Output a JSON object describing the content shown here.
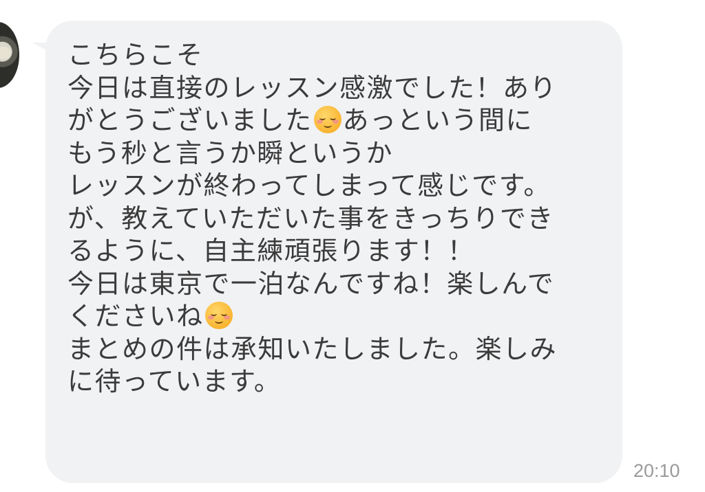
{
  "message": {
    "lines": [
      "こちらこそ",
      "今日は直接のレッスン感激でした！あり",
      "がとうございました",
      "あっという間に",
      "もう秒と言うか瞬というか",
      "レッスンが終わってしまって感じです。",
      "が、教えていただいた事をきっちりでき",
      "るように、自主練頑張ります！！",
      "今日は東京で一泊なんですね！楽しんで",
      "くださいね",
      "まとめの件は承知いたしました。楽しみ",
      "に待っています。"
    ],
    "emoji_name": "smiling-face-icon",
    "timestamp": "20:10"
  },
  "colors": {
    "bubble_background": "#f1f2f4",
    "message_text": "#3b3b3b",
    "timestamp_text": "#9a9a9a"
  }
}
